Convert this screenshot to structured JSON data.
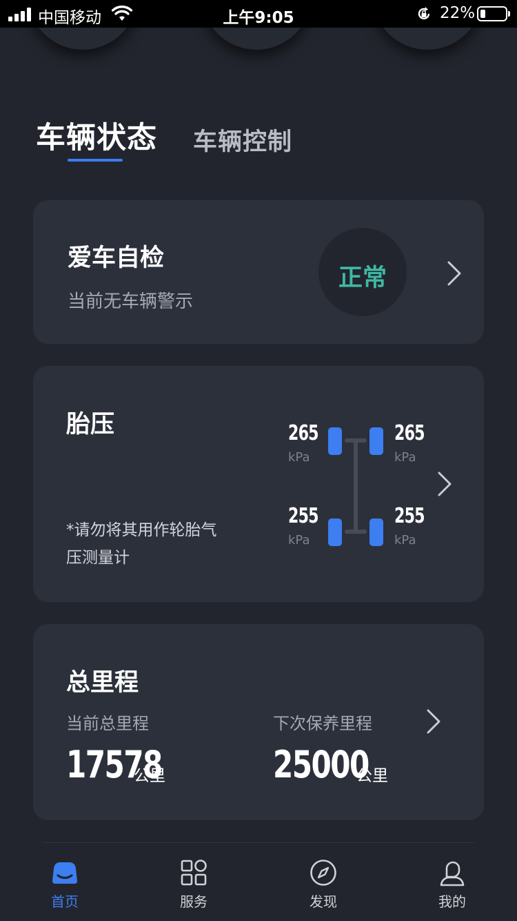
{
  "status_bar": {
    "carrier": "中国移动",
    "time": "上午9:05",
    "battery_percent": "22%",
    "battery_level": 0.22,
    "icons": [
      "signal-icon",
      "wifi-icon",
      "orientation-lock-icon",
      "battery-icon"
    ]
  },
  "tabs": [
    {
      "label": "车辆状态",
      "active": true
    },
    {
      "label": "车辆控制",
      "active": false
    }
  ],
  "self_check": {
    "title": "爱车自检",
    "subtitle": "当前无车辆警示",
    "status": "正常",
    "status_color": "#3fb8a3"
  },
  "tire_pressure": {
    "title": "胎压",
    "note": "*请勿将其用作轮胎气压测量计",
    "front_left": "265",
    "front_right": "265",
    "rear_left": "255",
    "rear_right": "255",
    "unit": "kPa"
  },
  "mileage": {
    "title": "总里程",
    "current_label": "当前总里程",
    "current_value": "17578",
    "next_service_label": "下次保养里程",
    "next_service_value": "25000",
    "unit": "公里"
  },
  "tabbar": [
    {
      "label": "首页",
      "icon": "car-icon",
      "active": true
    },
    {
      "label": "服务",
      "icon": "grid-icon",
      "active": false
    },
    {
      "label": "发现",
      "icon": "compass-icon",
      "active": false
    },
    {
      "label": "我的",
      "icon": "person-icon",
      "active": false
    }
  ],
  "colors": {
    "accent": "#3d7ef0",
    "background": "#22252d",
    "card": "#2c303b",
    "status_ok": "#3fb8a3"
  }
}
